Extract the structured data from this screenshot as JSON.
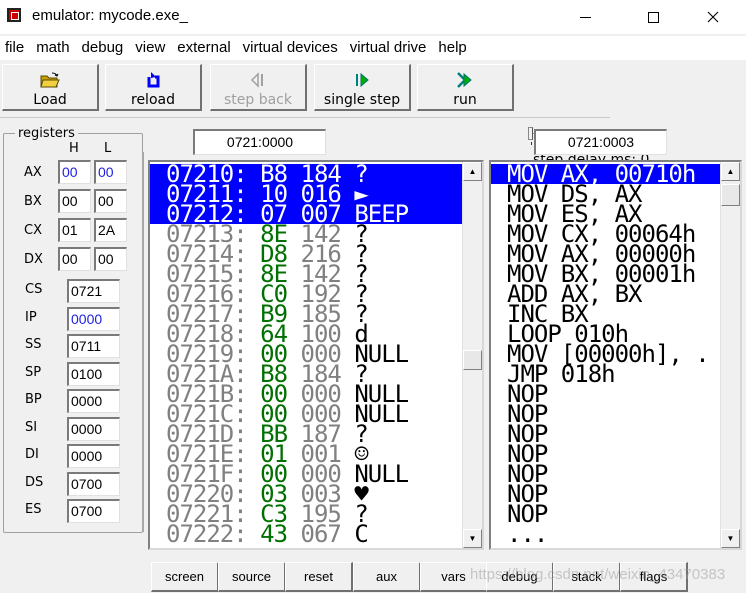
{
  "window": {
    "title": "emulator: mycode.exe_",
    "minimize_label": "minimize",
    "maximize_label": "maximize",
    "close_label": "close"
  },
  "menu": [
    "file",
    "math",
    "debug",
    "view",
    "external",
    "virtual devices",
    "virtual drive",
    "help"
  ],
  "toolbar": {
    "buttons": [
      {
        "label": "Load",
        "icon": "folder-open-icon",
        "enabled": true
      },
      {
        "label": "reload",
        "icon": "reload-icon",
        "enabled": true
      },
      {
        "label": "step back",
        "icon": "step-back-icon",
        "enabled": false
      },
      {
        "label": "single step",
        "icon": "single-step-icon",
        "enabled": true
      },
      {
        "label": "run",
        "icon": "run-icon",
        "enabled": true
      }
    ],
    "step_delay": {
      "label": "step delay ms: 0",
      "value_ms": 0,
      "position_fraction": 0
    }
  },
  "registers": {
    "title": "registers",
    "h_header": "H",
    "l_header": "L",
    "general": [
      {
        "name": "AX",
        "h": "00",
        "l": "00",
        "changed": true
      },
      {
        "name": "BX",
        "h": "00",
        "l": "00",
        "changed": false
      },
      {
        "name": "CX",
        "h": "01",
        "l": "2A",
        "changed": false
      },
      {
        "name": "DX",
        "h": "00",
        "l": "00",
        "changed": false
      }
    ],
    "segment": [
      {
        "name": "CS",
        "value": "0721",
        "changed": false
      },
      {
        "name": "IP",
        "value": "0000",
        "changed": true
      },
      {
        "name": "SS",
        "value": "0711",
        "changed": false
      },
      {
        "name": "SP",
        "value": "0100",
        "changed": false
      },
      {
        "name": "BP",
        "value": "0000",
        "changed": false
      },
      {
        "name": "SI",
        "value": "0000",
        "changed": false
      },
      {
        "name": "DI",
        "value": "0000",
        "changed": false
      },
      {
        "name": "DS",
        "value": "0700",
        "changed": false
      },
      {
        "name": "ES",
        "value": "0700",
        "changed": false
      }
    ]
  },
  "memory": {
    "address": "0721:0000",
    "rows": [
      {
        "addr": "07210:",
        "hex": "B8",
        "dec": "184",
        "chr": "?",
        "selected": true
      },
      {
        "addr": "07211:",
        "hex": "10",
        "dec": "016",
        "chr": "►",
        "selected": true
      },
      {
        "addr": "07212:",
        "hex": "07",
        "dec": "007",
        "chr": "BEEP",
        "selected": true
      },
      {
        "addr": "07213:",
        "hex": "8E",
        "dec": "142",
        "chr": "?",
        "selected": false
      },
      {
        "addr": "07214:",
        "hex": "D8",
        "dec": "216",
        "chr": "?",
        "selected": false
      },
      {
        "addr": "07215:",
        "hex": "8E",
        "dec": "142",
        "chr": "?",
        "selected": false
      },
      {
        "addr": "07216:",
        "hex": "C0",
        "dec": "192",
        "chr": "?",
        "selected": false
      },
      {
        "addr": "07217:",
        "hex": "B9",
        "dec": "185",
        "chr": "?",
        "selected": false
      },
      {
        "addr": "07218:",
        "hex": "64",
        "dec": "100",
        "chr": "d",
        "selected": false
      },
      {
        "addr": "07219:",
        "hex": "00",
        "dec": "000",
        "chr": "NULL",
        "selected": false
      },
      {
        "addr": "0721A:",
        "hex": "B8",
        "dec": "184",
        "chr": "?",
        "selected": false
      },
      {
        "addr": "0721B:",
        "hex": "00",
        "dec": "000",
        "chr": "NULL",
        "selected": false
      },
      {
        "addr": "0721C:",
        "hex": "00",
        "dec": "000",
        "chr": "NULL",
        "selected": false
      },
      {
        "addr": "0721D:",
        "hex": "BB",
        "dec": "187",
        "chr": "?",
        "selected": false
      },
      {
        "addr": "0721E:",
        "hex": "01",
        "dec": "001",
        "chr": "☺",
        "selected": false
      },
      {
        "addr": "0721F:",
        "hex": "00",
        "dec": "000",
        "chr": "NULL",
        "selected": false
      },
      {
        "addr": "07220:",
        "hex": "03",
        "dec": "003",
        "chr": "♥",
        "selected": false
      },
      {
        "addr": "07221:",
        "hex": "C3",
        "dec": "195",
        "chr": "?",
        "selected": false
      },
      {
        "addr": "07222:",
        "hex": "43",
        "dec": "067",
        "chr": "C",
        "selected": false
      }
    ]
  },
  "disassembly": {
    "address": "0721:0003",
    "rows": [
      {
        "text": "MOV AX, 00710h",
        "selected": true
      },
      {
        "text": "MOV DS, AX",
        "selected": false
      },
      {
        "text": "MOV ES, AX",
        "selected": false
      },
      {
        "text": "MOV CX, 00064h",
        "selected": false
      },
      {
        "text": "MOV AX, 00000h",
        "selected": false
      },
      {
        "text": "MOV BX, 00001h",
        "selected": false
      },
      {
        "text": "ADD AX, BX",
        "selected": false
      },
      {
        "text": "INC BX",
        "selected": false
      },
      {
        "text": "LOOP 010h",
        "selected": false
      },
      {
        "text": "MOV [00000h], .",
        "selected": false
      },
      {
        "text": "JMP 018h",
        "selected": false
      },
      {
        "text": "NOP",
        "selected": false
      },
      {
        "text": "NOP",
        "selected": false
      },
      {
        "text": "NOP",
        "selected": false
      },
      {
        "text": "NOP",
        "selected": false
      },
      {
        "text": "NOP",
        "selected": false
      },
      {
        "text": "NOP",
        "selected": false
      },
      {
        "text": "NOP",
        "selected": false
      },
      {
        "text": "...",
        "selected": false
      }
    ]
  },
  "bottom_buttons": [
    "screen",
    "source",
    "reset",
    "aux",
    "vars",
    "debug",
    "stack",
    "flags"
  ],
  "watermark": "https://blog.csdn.net/weixin_43470383",
  "colors": {
    "selection": "#0000ff",
    "hex_column": "#007000",
    "address_column": "#808080",
    "changed_register": "#2020e0"
  }
}
